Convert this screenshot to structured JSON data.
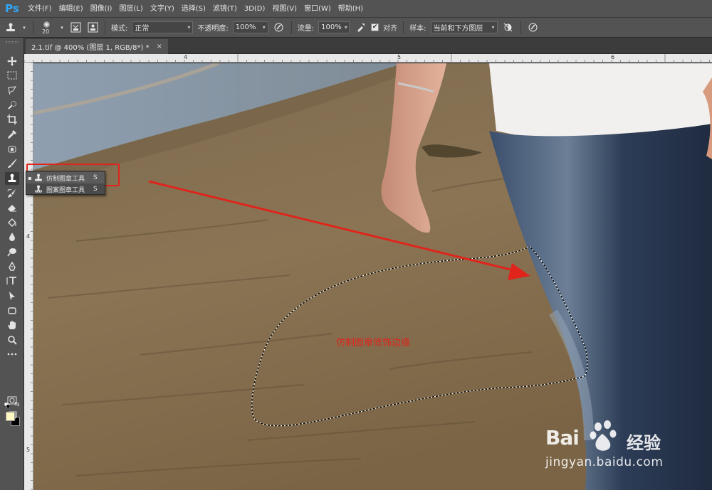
{
  "app": {
    "logo": "Ps",
    "menus": [
      "文件(F)",
      "编辑(E)",
      "图像(I)",
      "图层(L)",
      "文字(Y)",
      "选择(S)",
      "滤镜(T)",
      "3D(D)",
      "视图(V)",
      "窗口(W)",
      "帮助(H)"
    ]
  },
  "options": {
    "brush_size": "20",
    "mode_label": "模式:",
    "mode_value": "正常",
    "opacity_label": "不透明度:",
    "opacity_value": "100%",
    "flow_label": "流量:",
    "flow_value": "100%",
    "aligned_label": "对齐",
    "aligned_checked": true,
    "sample_label": "样本:",
    "sample_value": "当前和下方图层"
  },
  "document": {
    "tab_title": "2.1.tif @ 400% (图层 1, RGB/8*) *",
    "close_glyph": "×"
  },
  "rulers": {
    "top": [
      "4",
      "5",
      "6"
    ],
    "left": [
      "4",
      "5"
    ]
  },
  "flyout": {
    "items": [
      {
        "name": "仿制图章工具",
        "key": "S",
        "selected": true
      },
      {
        "name": "图案图章工具",
        "key": "S",
        "selected": false
      }
    ]
  },
  "colors": {
    "foreground": "#fff9c2",
    "background": "#000000",
    "annotation": "#e0241b"
  },
  "annotation": {
    "text": "仿制图章修饰边缘"
  },
  "watermark": {
    "brand_latin": "Bai",
    "brand_cn": "经验",
    "url": "jingyan.baidu.com"
  }
}
